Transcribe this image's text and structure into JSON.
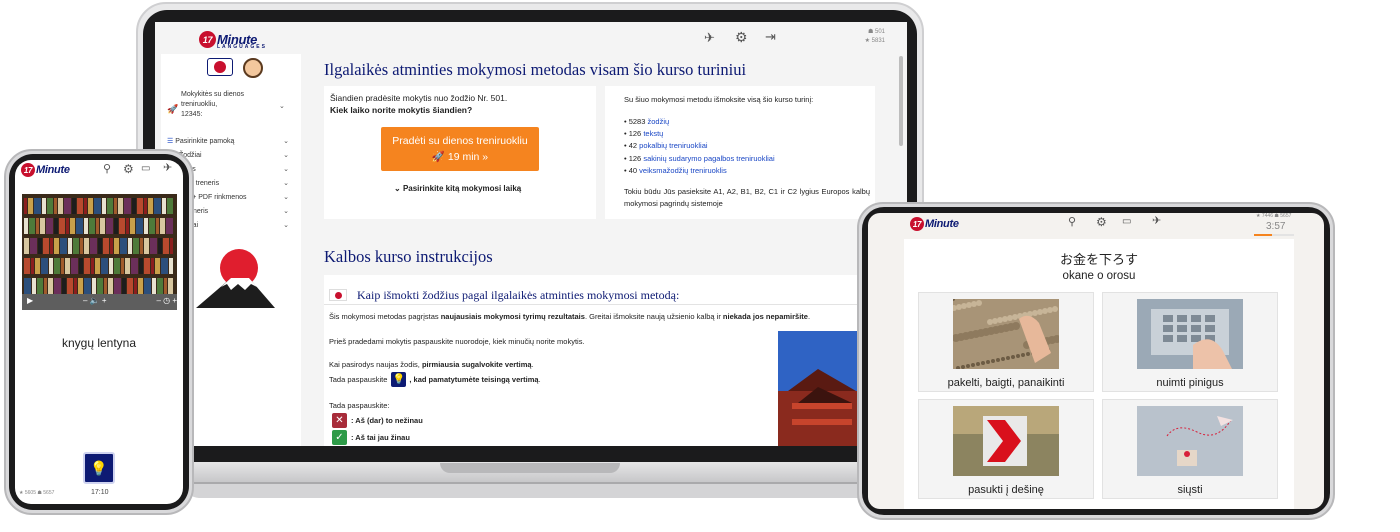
{
  "laptop": {
    "logo": {
      "num": "17",
      "word": "Minute",
      "sub": "LANGUAGES"
    },
    "stats": {
      "words": "501",
      "stars": "5831"
    },
    "sidebar": {
      "trainer_label_line1": "Mokykitės su dienos",
      "trainer_label_line2": "treniruokliu,",
      "trainer_label_line3": "12345:",
      "items": [
        {
          "label": "Pasirinkite pamoką"
        },
        {
          "label": "Žodžiai"
        },
        {
          "label": "logas"
        },
        {
          "label": "albio treneris"
        },
        {
          "label": "eris + PDF rinkmenos"
        },
        {
          "label": "p treneris"
        },
        {
          "label": "domai"
        }
      ]
    },
    "main": {
      "title": "Ilgalaikės atminties mokymosi metodas visam šio kurso turiniui",
      "left_card": {
        "line1": "Šiandien pradėsite mokytis nuo žodžio Nr. 501.",
        "line2": "Kiek laiko norite mokytis šiandien?",
        "start_button_line1": "Pradėti su dienos treniruokliu",
        "start_button_line2": "19 min  »",
        "other_time": "Pasirinkite kitą mokymosi laiką"
      },
      "right_card": {
        "intro": "Su šiuo mokymosi metodu išmoksite visą šio kurso turinį:",
        "items": [
          {
            "count": "• 5283",
            "label": "žodžių"
          },
          {
            "count": "• 126",
            "label": "tekstų"
          },
          {
            "count": "• 42",
            "label": "pokalbių treniruokliai"
          },
          {
            "count": "• 126",
            "label": "sakinių sudarymo pagalbos treniruokliai"
          },
          {
            "count": "• 40",
            "label": "veiksmažodžių treniruoklis"
          }
        ],
        "outro": "Tokiu būdu Jūs pasieksite A1, A2, B1, B2, C1 ir C2 lygius Europos kalbų mokymosi pagrindų sistemoje"
      },
      "instructions_title": "Kalbos kurso instrukcijos",
      "instructions": {
        "subtitle": "Kaip išmokti žodžius pagal ilgalaikės atminties mokymosi metodą:",
        "p1_a": "Šis mokymosi metodas pagrįstas ",
        "p1_b": "naujausiais mokymosi tyrimų rezultatais",
        "p1_c": ". Greitai išmoksite naują užsienio kalbą ir ",
        "p1_d": "niekada jos nepamiršite",
        "p1_e": ".",
        "p2": "Prieš pradedami mokytis paspauskite nuorodoje, kiek minučių norite mokytis.",
        "p3_a": "Kai pasirodys naujas žodis, ",
        "p3_b": "pirmiausia sugalvokite vertimą",
        "p3_c": ".",
        "p4_a": "Tada paspauskite",
        "p4_b": ", kad pamatytumėte teisingą vertimą",
        "p4_c": ".",
        "p5": "Tada paspauskite:",
        "no_label": ": Aš (dar) to nežinau",
        "yes_label": ": Aš tai jau žinau"
      }
    }
  },
  "phone": {
    "word": "knygų lentyna",
    "time": "17:10",
    "stats": "★ 5605  ☗ 5657",
    "colors": {
      "video_bg": "#3a2a1a"
    }
  },
  "tablet": {
    "stats": "★ 7446  ☗ 5657",
    "timer": "3:57",
    "word": "お金を下ろす",
    "romaji": "okane o orosu",
    "options": [
      {
        "label": "pakelti, baigti, panaikinti"
      },
      {
        "label": "nuimti pinigus"
      },
      {
        "label": "pasukti į dešinę"
      },
      {
        "label": "siųsti"
      }
    ]
  },
  "colors": {
    "brand_navy": "#0d1a73",
    "brand_red": "#c8102e",
    "accent_orange": "#f5841f",
    "link": "#1a47c5"
  }
}
